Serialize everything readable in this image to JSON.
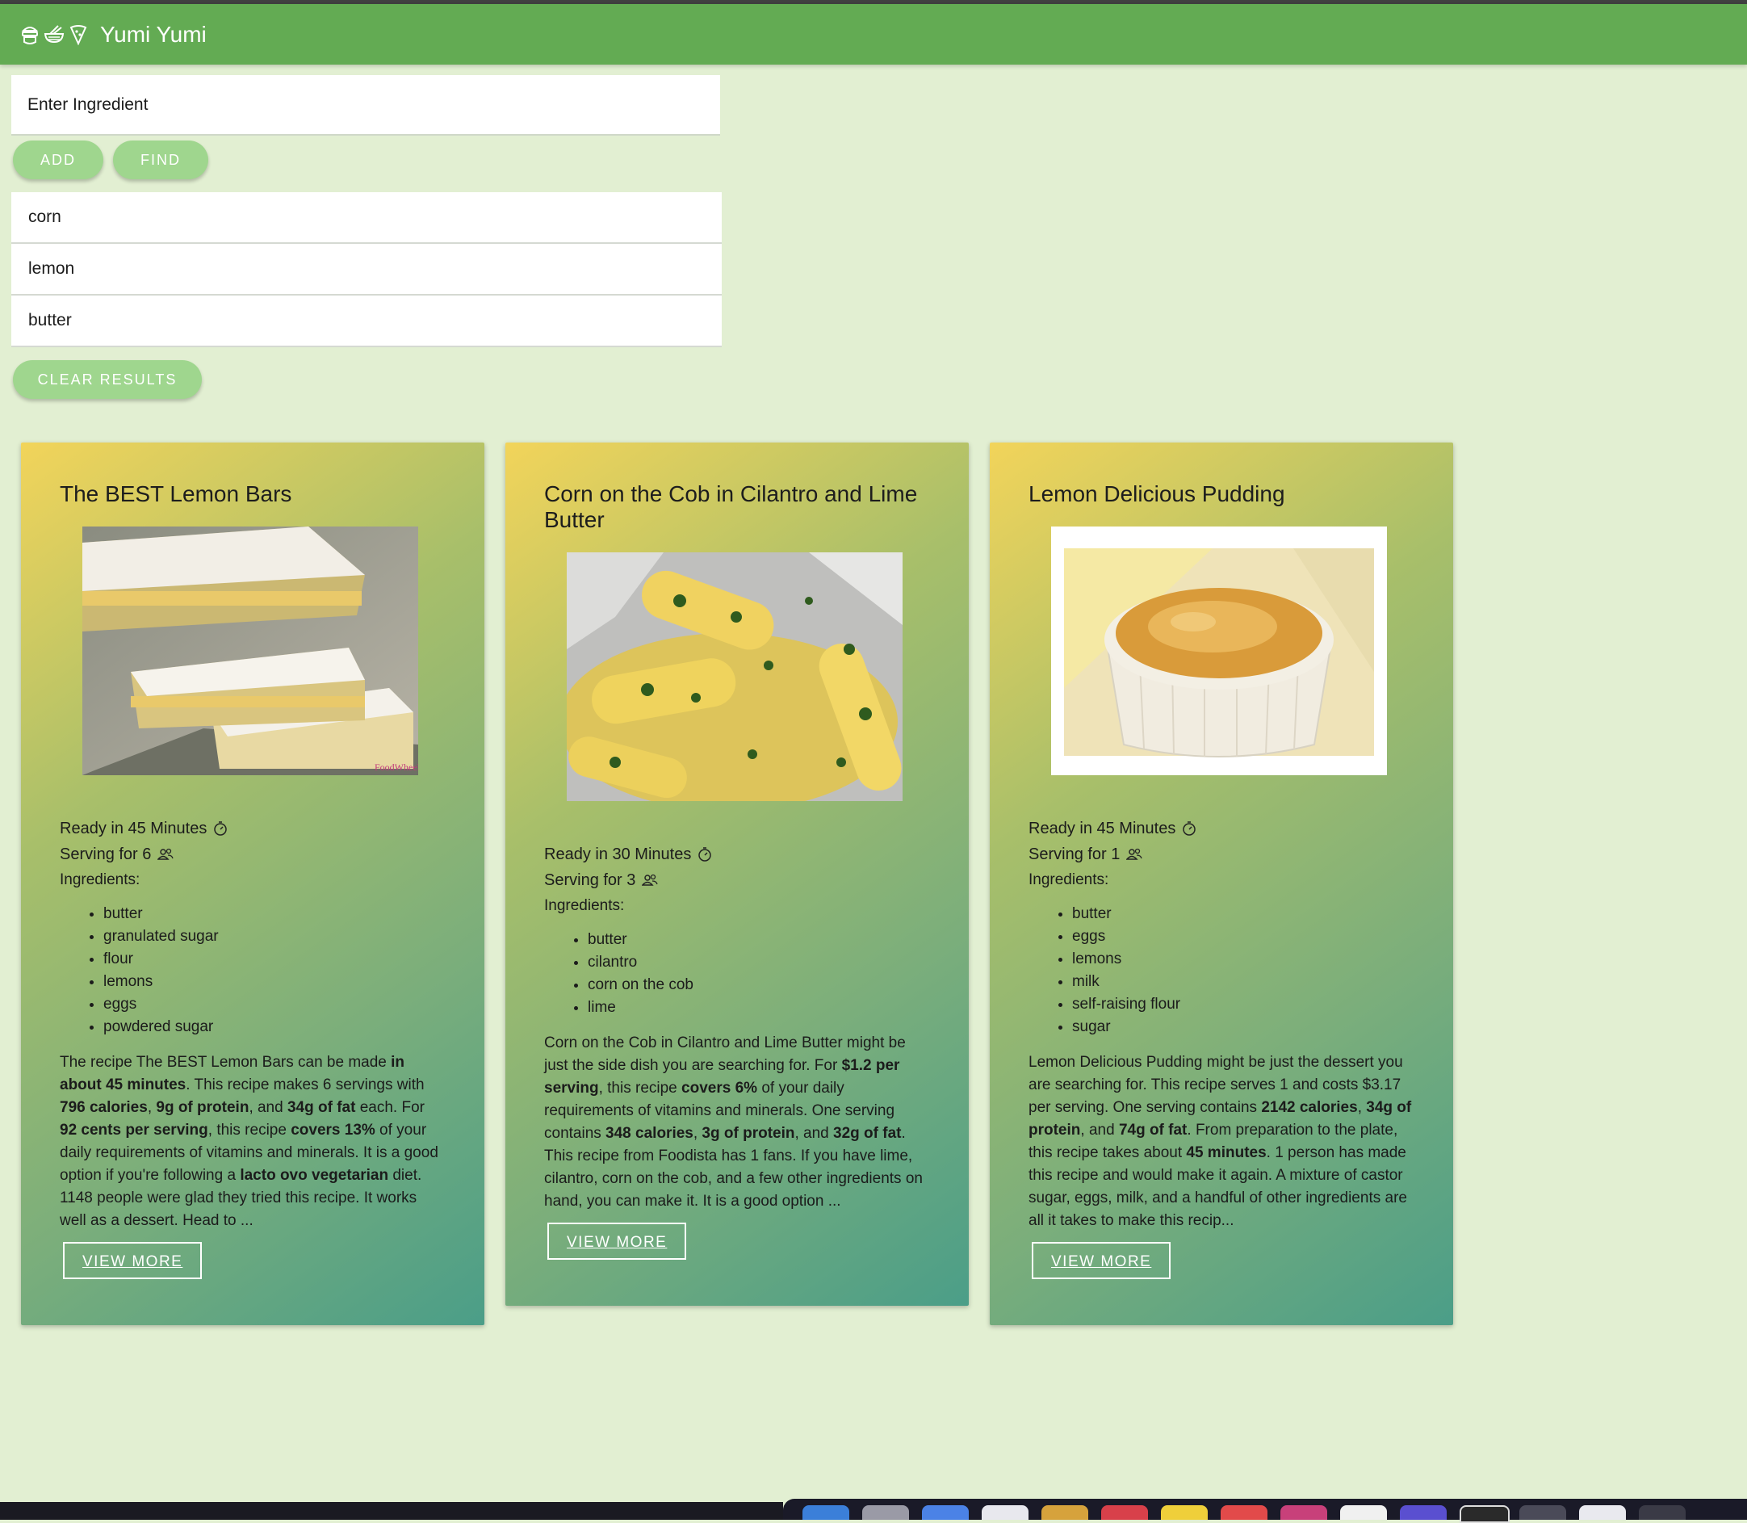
{
  "app": {
    "title": "Yumi Yumi"
  },
  "search": {
    "placeholder": "Enter Ingredient",
    "add_label": "ADD",
    "find_label": "FIND"
  },
  "ingredients": [
    "corn",
    "lemon",
    "butter"
  ],
  "clear_label": "CLEAR RESULTS",
  "cards": [
    {
      "title": "The BEST Lemon Bars",
      "ready": "Ready in 45 Minutes",
      "serving": "Serving for 6",
      "ingredients_label": "Ingredients:",
      "ingredients": [
        "butter",
        "granulated sugar",
        "flour",
        "lemons",
        "eggs",
        "powdered sugar"
      ],
      "summary_parts": [
        "The recipe The BEST Lemon Bars can be made ",
        "in about 45 minutes",
        ". This recipe makes 6 servings with ",
        "796 calories",
        ", ",
        "9g of protein",
        ", and ",
        "34g of fat",
        " each. For ",
        "92 cents per serving",
        ", this recipe ",
        "covers 13%",
        " of your daily requirements of vitamins and minerals. It is a good option if you're following a ",
        "lacto ovo vegetarian",
        " diet. 1148 people were glad they tried this recipe. It works well as a dessert. Head to ..."
      ],
      "view_more": "VIEW MORE"
    },
    {
      "title": "Corn on the Cob in Cilantro and Lime Butter",
      "ready": "Ready in 30 Minutes",
      "serving": "Serving for 3",
      "ingredients_label": "Ingredients:",
      "ingredients": [
        "butter",
        "cilantro",
        "corn on the cob",
        "lime"
      ],
      "summary_parts": [
        "Corn on the Cob in Cilantro and Lime Butter might be just the side dish you are searching for. For ",
        "$1.2 per serving",
        ", this recipe ",
        "covers 6%",
        " of your daily requirements of vitamins and minerals. One serving contains ",
        "348 calories",
        ", ",
        "3g of protein",
        ", and ",
        "32g of fat",
        ". This recipe from Foodista has 1 fans. If you have lime, cilantro, corn on the cob, and a few other ingredients on hand, you can make it. It is a good option ..."
      ],
      "view_more": "VIEW MORE"
    },
    {
      "title": "Lemon Delicious Pudding",
      "ready": "Ready in 45 Minutes",
      "serving": "Serving for 1",
      "ingredients_label": "Ingredients:",
      "ingredients": [
        "butter",
        "eggs",
        "lemons",
        "milk",
        "self-raising flour",
        "sugar"
      ],
      "summary_parts": [
        "Lemon Delicious Pudding might be just the dessert you are searching for. This recipe serves 1 and costs $3.17 per serving. One serving contains ",
        "2142 calories",
        ", ",
        "34g of protein",
        ", and ",
        "74g of fat",
        ". From preparation to the plate, this recipe takes about ",
        "45 minutes",
        ". 1 person has made this recipe and would make it again. A mixture of castor sugar, eggs, milk, and a handful of other ingredients are all it takes to make this recip..."
      ],
      "view_more": "VIEW MORE"
    }
  ],
  "colors": {
    "appbar": "#63ab53",
    "background": "#e2efd2",
    "button": "#9fd68e"
  },
  "icons": [
    "burger-icon",
    "noodle-bowl-icon",
    "pizza-icon",
    "timer-icon",
    "people-icon",
    "image-watermark"
  ],
  "watermark": "FoodWheels"
}
